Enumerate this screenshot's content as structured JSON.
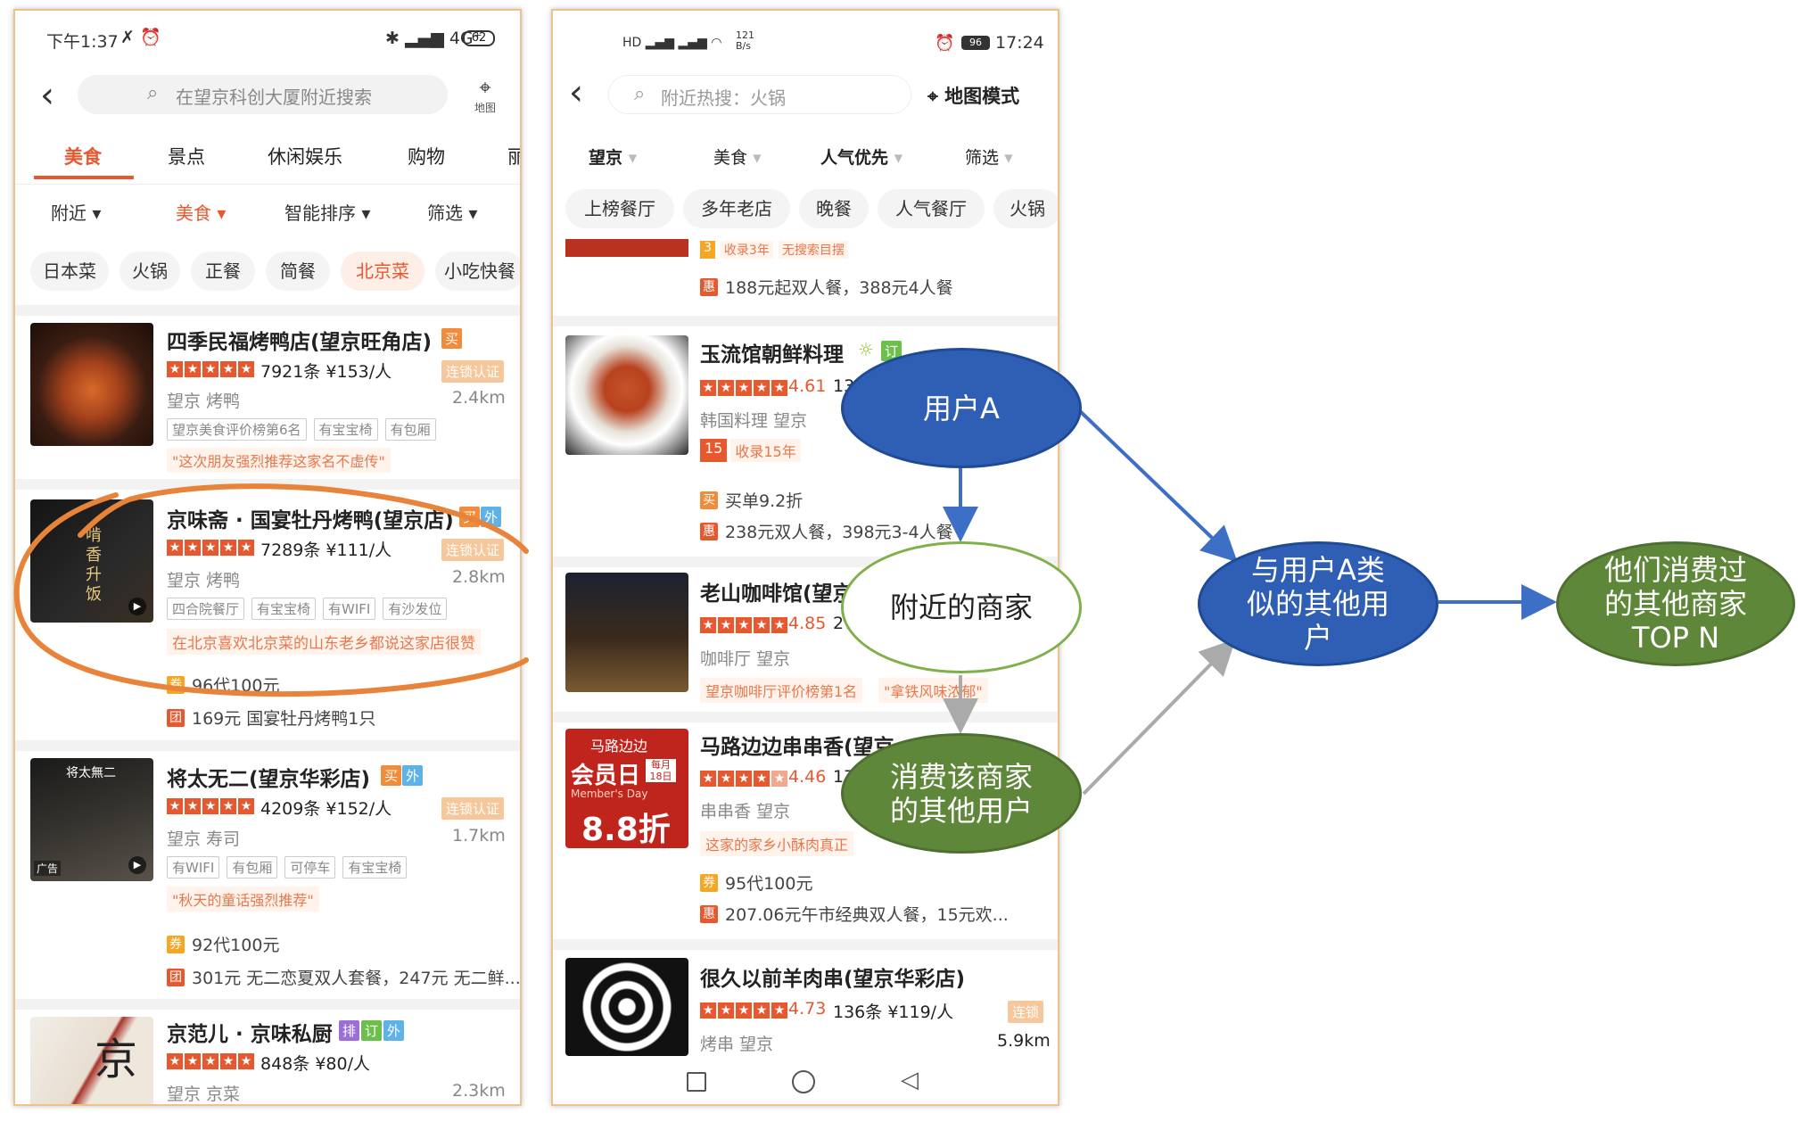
{
  "left": {
    "status": {
      "time": "下午1:37",
      "signal": "4G⁺",
      "battery": "62"
    },
    "search": {
      "placeholder": "在望京科创大厦附近搜索",
      "map_label": "地图"
    },
    "tabs": [
      "美食",
      "景点",
      "休闲娱乐",
      "购物",
      "丽"
    ],
    "filters": [
      "附近",
      "美食",
      "智能排序",
      "筛选"
    ],
    "chips": [
      "日本菜",
      "火锅",
      "正餐",
      "简餐",
      "北京菜",
      "小吃快餐"
    ],
    "shops": [
      {
        "name": "四季民福烤鸭店(望京旺角店)",
        "badges": [
          "买"
        ],
        "reviews": "7921条",
        "price": "¥153/人",
        "cert": "连锁认证",
        "area": "望京  烤鸭",
        "dist": "2.4km",
        "tags": [
          "望京美食评价榜第6名",
          "有宝宝椅",
          "有包厢"
        ],
        "quote": "\"这次朋友强烈推荐这家名不虚传\""
      },
      {
        "name": "京味斋 · 国宴牡丹烤鸭(望京店)",
        "badges": [
          "买",
          "外"
        ],
        "reviews": "7289条",
        "price": "¥111/人",
        "cert": "连锁认证",
        "area": "望京  烤鸭",
        "dist": "2.8km",
        "tags": [
          "四合院餐厅",
          "有宝宝椅",
          "有WIFI",
          "有沙发位"
        ],
        "quote": "在北京喜欢北京菜的山东老乡都说这家店很赞",
        "deal1": "96代100元",
        "deal2": "169元 国宴牡丹烤鸭1只"
      },
      {
        "name": "将太无二(望京华彩店)",
        "badges": [
          "买",
          "外"
        ],
        "reviews": "4209条",
        "price": "¥152/人",
        "cert": "连锁认证",
        "area": "望京  寿司",
        "dist": "1.7km",
        "tags": [
          "有WIFI",
          "有包厢",
          "可停车",
          "有宝宝椅"
        ],
        "quote": "\"秋天的童话强烈推荐\"",
        "deal1": "92代100元",
        "deal2": "301元 无二恋夏双人套餐，247元 无二鲜...",
        "ad": "广告"
      },
      {
        "name": "京范儿 · 京味私厨",
        "badges": [
          "排",
          "订",
          "外"
        ],
        "reviews": "848条",
        "price": "¥80/人",
        "area": "望京  京菜",
        "dist": "2.3km"
      }
    ]
  },
  "right": {
    "status": {
      "time": "17:24",
      "battery": "96",
      "speed": "121 B/s"
    },
    "search": {
      "placeholder": "附近热搜：火锅",
      "map_mode": "地图模式"
    },
    "filters": [
      "望京",
      "美食",
      "人气优先",
      "筛选"
    ],
    "chips": [
      "上榜餐厅",
      "多年老店",
      "晚餐",
      "人气餐厅",
      "火锅"
    ],
    "top_deal": {
      "tag_num": "3",
      "tag1": "收录3年",
      "tag2": "无搜索目摆",
      "deal": "188元起双人餐，388元4人餐"
    },
    "shops": [
      {
        "name": "玉流馆朝鲜料理",
        "rating": "4.61",
        "reviews": "135",
        "area": "韩国料理  望京",
        "years_num": "15",
        "years": "收录15年",
        "deal1": "买单9.2折",
        "deal2": "238元双人餐，398元3-4人餐"
      },
      {
        "name": "老山咖啡馆(望京",
        "rating": "4.85",
        "reviews": "27",
        "area": "咖啡厅  望京",
        "rank": "望京咖啡厅评价榜第1名",
        "quote": "\"拿铁风味浓郁\""
      },
      {
        "name": "马路边边串串香(望京一店)",
        "rating": "4.46",
        "reviews": "172",
        "area": "串串香  望京",
        "quote": "这家的家乡小酥肉真正",
        "deal1": "95代100元",
        "deal2": "207.06元午市经典双人餐，15元欢..."
      },
      {
        "name": "很久以前羊肉串(望京华彩店)",
        "rating": "4.73",
        "reviews": "136条",
        "price": "¥119/人",
        "cert": "连锁",
        "area": "烤串  望京",
        "dist": "5.9km"
      }
    ],
    "poster": {
      "line1": "马路边边",
      "line2": "会员日",
      "line3": "Member's Day",
      "line4": "每月18日",
      "line5": "8.8折"
    }
  },
  "diagram": {
    "user_a": "用户A",
    "nearby": "附近的商家",
    "consumers": [
      "消费该商家",
      "的其他用户"
    ],
    "similar": [
      "与用户A类",
      "似的其他用",
      "户"
    ],
    "topn": [
      "他们消费过",
      "的其他商家",
      "TOP N"
    ]
  },
  "colors": {
    "accent": "#e8582f",
    "blue_node": "#2f5eb5",
    "green_node": "#5f873a",
    "circle_mark": "#e8833a"
  }
}
